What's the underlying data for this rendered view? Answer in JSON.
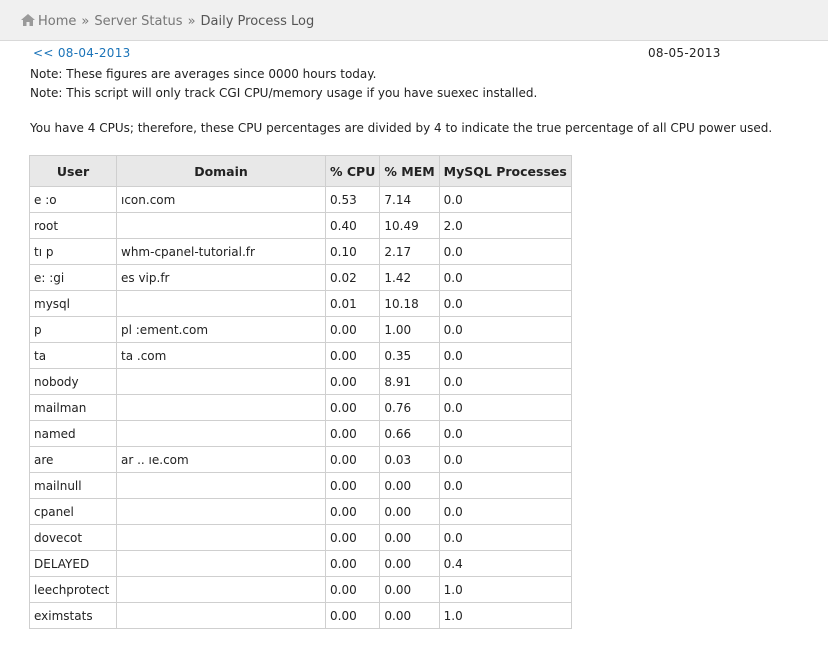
{
  "breadcrumb": {
    "home": "Home",
    "separator": "»",
    "server_status": "Server Status",
    "current": "Daily Process Log"
  },
  "date_nav": {
    "prev": "<< 08-04-2013",
    "current": "08-05-2013"
  },
  "notes": {
    "averages": "Note: These figures are averages since 0000 hours today.",
    "suexec": "Note: This script will only track CGI CPU/memory usage if you have suexec installed.",
    "cpus": "You have 4 CPUs; therefore, these CPU percentages are divided by 4 to indicate the true percentage of all CPU power used."
  },
  "table": {
    "headers": [
      "User",
      "Domain",
      "% CPU",
      "% MEM",
      "MySQL Processes"
    ],
    "rows": [
      {
        "user": "e          :o",
        "domain": "        ıcon.com",
        "cpu": "0.53",
        "mem": "7.14",
        "mysql": "0.0"
      },
      {
        "user": "root",
        "domain": "",
        "cpu": "0.40",
        "mem": "10.49",
        "mysql": "2.0"
      },
      {
        "user": "tı    p",
        "domain": "whm-cpanel-tutorial.fr",
        "cpu": "0.10",
        "mem": "2.17",
        "mysql": "0.0"
      },
      {
        "user": "e:      :gi",
        "domain": "es                vip.fr",
        "cpu": "0.02",
        "mem": "1.42",
        "mysql": "0.0"
      },
      {
        "user": "mysql",
        "domain": "",
        "cpu": "0.01",
        "mem": "10.18",
        "mysql": "0.0"
      },
      {
        "user": "p",
        "domain": "pl                         :ement.com",
        "cpu": "0.00",
        "mem": "1.00",
        "mysql": "0.0"
      },
      {
        "user": "ta",
        "domain": "ta                      .com",
        "cpu": "0.00",
        "mem": "0.35",
        "mysql": "0.0"
      },
      {
        "user": "nobody",
        "domain": "",
        "cpu": "0.00",
        "mem": "8.91",
        "mysql": "0.0"
      },
      {
        "user": "mailman",
        "domain": "",
        "cpu": "0.00",
        "mem": "0.76",
        "mysql": "0.0"
      },
      {
        "user": "named",
        "domain": "",
        "cpu": "0.00",
        "mem": "0.66",
        "mysql": "0.0"
      },
      {
        "user": "are",
        "domain": "ar                  ..           ıe.com",
        "cpu": "0.00",
        "mem": "0.03",
        "mysql": "0.0"
      },
      {
        "user": "mailnull",
        "domain": "",
        "cpu": "0.00",
        "mem": "0.00",
        "mysql": "0.0"
      },
      {
        "user": "cpanel",
        "domain": "",
        "cpu": "0.00",
        "mem": "0.00",
        "mysql": "0.0"
      },
      {
        "user": "dovecot",
        "domain": "",
        "cpu": "0.00",
        "mem": "0.00",
        "mysql": "0.0"
      },
      {
        "user": "DELAYED",
        "domain": "",
        "cpu": "0.00",
        "mem": "0.00",
        "mysql": "0.4"
      },
      {
        "user": "leechprotect",
        "domain": "",
        "cpu": "0.00",
        "mem": "0.00",
        "mysql": "1.0"
      },
      {
        "user": "eximstats",
        "domain": "",
        "cpu": "0.00",
        "mem": "0.00",
        "mysql": "1.0"
      }
    ]
  },
  "colors": {
    "link": "#1a73b8",
    "breadcrumb_bg": "#f0f0f0",
    "header_bg": "#e8e8e8",
    "border": "#cfcfcf"
  },
  "icons": {
    "home": "home-icon"
  }
}
